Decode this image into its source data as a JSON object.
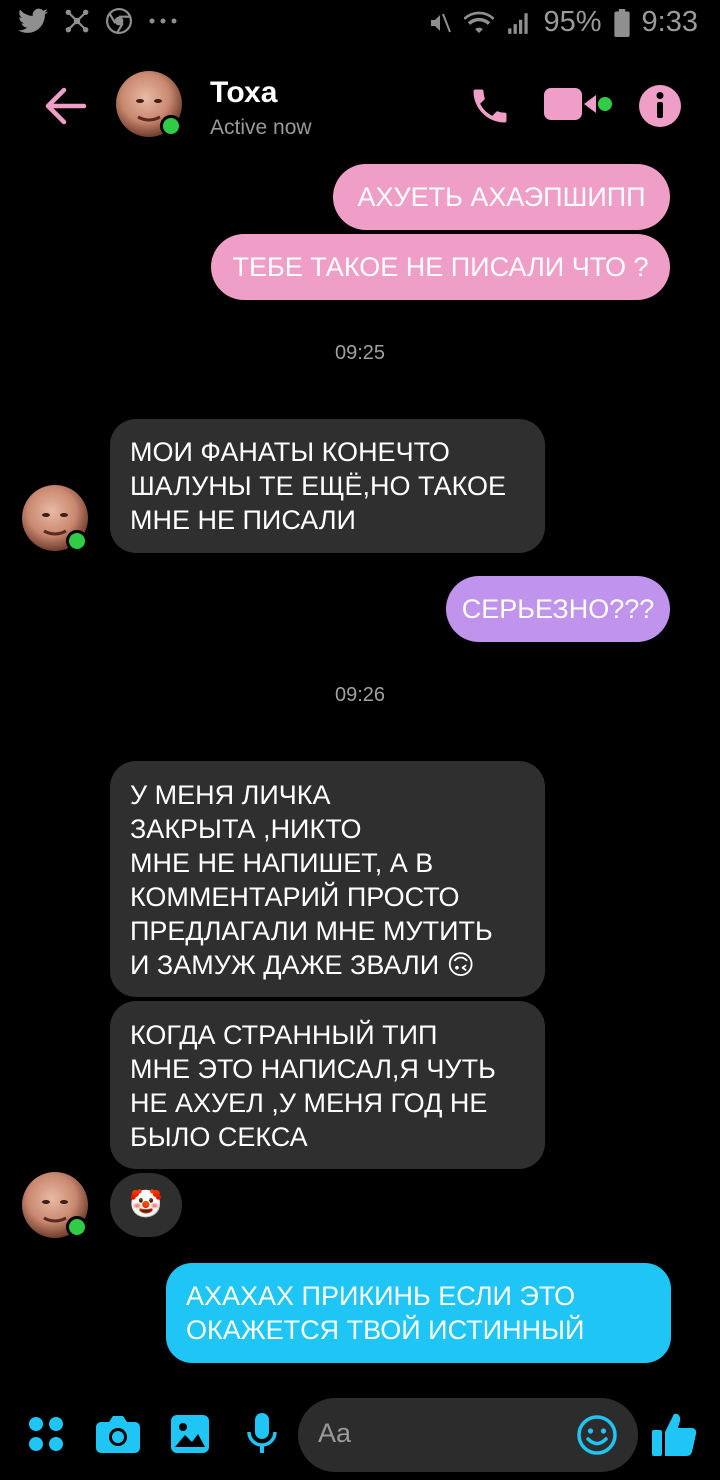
{
  "status_bar": {
    "battery": "95%",
    "time": "9:33"
  },
  "header": {
    "contact_name": "Тоха",
    "contact_status": "Active now",
    "icons": [
      "back-arrow-icon",
      "phone-icon",
      "video-camera-icon",
      "info-icon"
    ],
    "accent_color": "#ee9ec7"
  },
  "messages": [
    {
      "id": "m1",
      "direction": "out",
      "text": "АХУЕТЬ АХАЭПШИПП"
    },
    {
      "id": "m2",
      "direction": "out",
      "text": "ТЕБЕ ТАКОЕ НЕ ПИСАЛИ ЧТО ?"
    },
    {
      "id": "ts1",
      "type": "timestamp",
      "text": "09:25"
    },
    {
      "id": "m3",
      "direction": "in",
      "text": "МОИ ФАНАТЫ КОНЕЧТО\nШАЛУНЫ ТЕ ЕЩЁ,НО ТАКОЕ\nМНЕ НЕ ПИСАЛИ"
    },
    {
      "id": "m4",
      "direction": "out",
      "text": "СЕРЬЕЗНО???"
    },
    {
      "id": "ts2",
      "type": "timestamp",
      "text": "09:26"
    },
    {
      "id": "m5",
      "direction": "in",
      "text": "У МЕНЯ ЛИЧКА\nЗАКРЫТА ,НИКТО\nМНЕ НЕ НАПИШЕТ, А В\nКОММЕНТАРИЙ ПРОСТО\nПРЕДЛАГАЛИ МНЕ МУТИТЬ\nИ ЗАМУЖ ДАЖЕ ЗВАЛИ 🙃"
    },
    {
      "id": "m6",
      "direction": "in",
      "text": "КОГДА СТРАННЫЙ ТИП\nМНЕ ЭТО НАПИСАЛ,Я ЧУТЬ\nНЕ АХУЕЛ ,У МЕНЯ ГОД НЕ\nБЫЛО СЕКСА"
    },
    {
      "id": "m7",
      "direction": "in",
      "text": "🤡"
    },
    {
      "id": "m8",
      "direction": "out",
      "text": "АХАХАХ ПРИКИНЬ ЕСЛИ ЭТО\nОКАЖЕТСЯ ТВОЙ ИСТИННЫЙ"
    }
  ],
  "composer": {
    "placeholder": "Aa",
    "icons": [
      "apps-grid-icon",
      "camera-icon",
      "gallery-icon",
      "microphone-icon",
      "emoji-icon",
      "thumbs-up-icon"
    ],
    "accent_color": "#1ec5f5"
  }
}
